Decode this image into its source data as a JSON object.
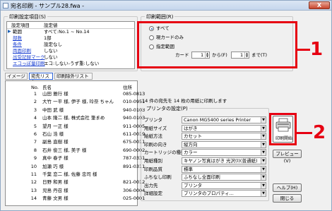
{
  "window": {
    "title": "宛名印刷 - サンプル28.fwa -",
    "close_label": "X"
  },
  "settings": {
    "group_label": "印刷設定項目(S)",
    "headers": [
      "設定項目",
      "設定値"
    ],
    "rows": [
      {
        "item": "範囲",
        "value": "すべて:No.1 ~ No.14",
        "link": false,
        "selected": true
      },
      {
        "item": "部数",
        "value": "1部",
        "link": true
      },
      {
        "item": "条件",
        "value": "設定なし",
        "link": true
      },
      {
        "item": "両面印刷",
        "value": "しない",
        "link": true
      },
      {
        "item": "出受記録マーク",
        "value": "しない",
        "link": true
      },
      {
        "item": "エコっぽ量印刷",
        "value": "エコ:しない-うず重:しない",
        "link": true
      }
    ]
  },
  "tabs": [
    "イメージ",
    "宛先リスト",
    "印刷除外リスト"
  ],
  "list": {
    "headers": {
      "no": "No.",
      "name": "氏名",
      "address": "住所"
    },
    "rows": [
      {
        "no": "1",
        "name": "山田 雅行 様",
        "address": "085-0813"
      },
      {
        "no": "2",
        "name": "大竹 一平 様, 伊子 様, 玲奈 ちゃん",
        "address": "010-0951"
      },
      {
        "no": "3",
        "name": "中田 武 様",
        "address": "940-0103"
      },
      {
        "no": "4",
        "name": "山本 隆二 様, 株式会社 筆まめ",
        "address": "940-0103"
      },
      {
        "no": "5",
        "name": "望月 一正 様",
        "address": "911-0005"
      },
      {
        "no": "6",
        "name": "石山 浩 様",
        "address": "611-0019"
      },
      {
        "no": "7",
        "name": "副島 直樹 様",
        "address": "675-0011"
      },
      {
        "no": "8",
        "name": "石井 俊三 様, 美子 様",
        "address": "690-0002"
      },
      {
        "no": "9",
        "name": "真中 春子 様",
        "address": "787-0331"
      },
      {
        "no": "10",
        "name": "加瀬 巧 様",
        "address": "891-0311"
      },
      {
        "no": "11",
        "name": "千葉 恋二 様, 佐藤 忠司 様",
        "address": ""
      },
      {
        "no": "12",
        "name": "日野 和男 様",
        "address": "821-0012"
      },
      {
        "no": "13",
        "name": "児島 丹召 様",
        "address": "306-0004"
      },
      {
        "no": "14",
        "name": "青藤 文男 様",
        "address": "025-0001"
      }
    ]
  },
  "range": {
    "group_label": "印刷範囲(R)",
    "options": [
      "すべて",
      "現カードのみ",
      "指定範囲"
    ],
    "card_label": "カード",
    "from_value": "1",
    "from_label": "から(F)",
    "to_value": "1",
    "to_label": "まで(T)"
  },
  "info_text": "14 件の宛先を 14 枚の用紙に印刷します",
  "printer": {
    "group_label": "プリンタの設定(P)",
    "rows": [
      {
        "label": "プリンタ",
        "value": "Canon MG5400 series Printer"
      },
      {
        "label": "用紙サイズ",
        "value": "はがき"
      },
      {
        "label": "給紙方法",
        "value": "カセット"
      },
      {
        "label": "印刷の向き",
        "value": "縦方向"
      },
      {
        "label": "カートリッジの種類",
        "value": "カラー"
      },
      {
        "label": "用紙種別",
        "value": "キヤノン写真はがき 光沢(l)(普通紙)"
      },
      {
        "label": "印刷品質",
        "value": "標準"
      },
      {
        "label": "ふちなし印刷",
        "value": "ふちなし全面印刷"
      },
      {
        "label": "出力先",
        "value": "プリンタ"
      },
      {
        "label": "詳細設定",
        "value": "プリンタのプロパティ..."
      }
    ]
  },
  "buttons": {
    "print": "印刷開始",
    "preview": "プレビュー(V)",
    "help": "ヘルプ(H)",
    "close": "閉じる"
  },
  "callouts": {
    "one": "1",
    "two": "2"
  }
}
